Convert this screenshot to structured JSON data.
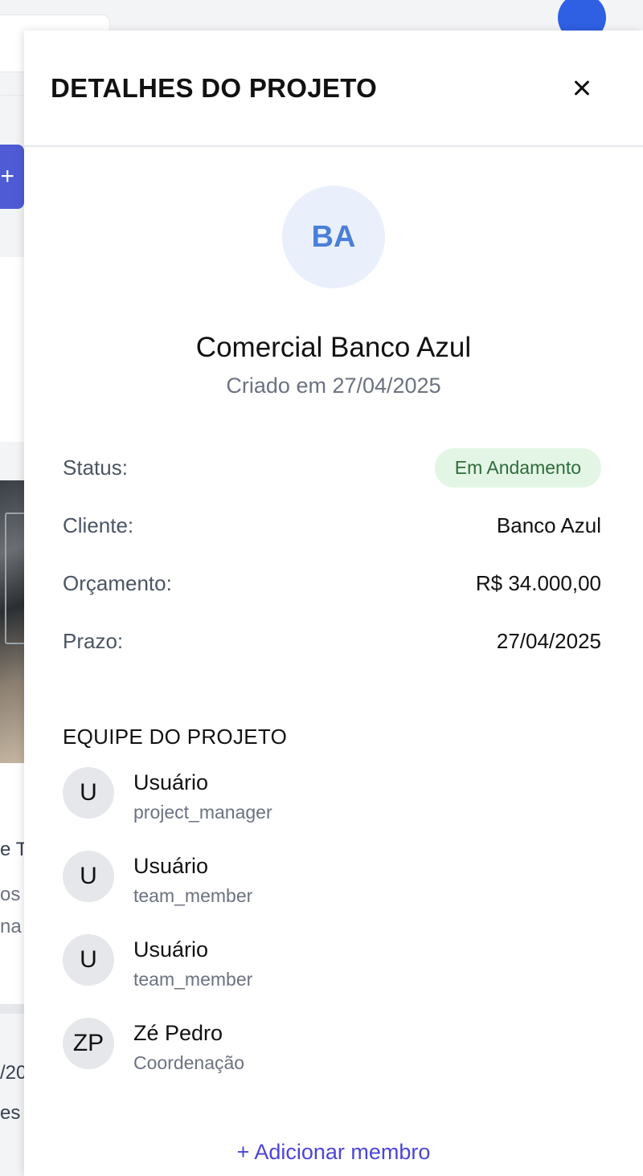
{
  "background": {
    "add_symbol": "+",
    "text_fragments": [
      "e T",
      "os",
      "na",
      "/20",
      "es"
    ]
  },
  "drawer": {
    "title": "DETALHES DO PROJETO",
    "close_icon": "close-icon"
  },
  "project": {
    "initials": "BA",
    "name": "Comercial Banco Azul",
    "created": "Criado em 27/04/2025"
  },
  "details": {
    "status_label": "Status:",
    "status_value": "Em Andamento",
    "client_label": "Cliente:",
    "client_value": "Banco Azul",
    "budget_label": "Orçamento:",
    "budget_value": "R$ 34.000,00",
    "deadline_label": "Prazo:",
    "deadline_value": "27/04/2025"
  },
  "team": {
    "title": "EQUIPE DO PROJETO",
    "members": [
      {
        "initials": "U",
        "name": "Usuário",
        "role": "project_manager"
      },
      {
        "initials": "U",
        "name": "Usuário",
        "role": "team_member"
      },
      {
        "initials": "U",
        "name": "Usuário",
        "role": "team_member"
      },
      {
        "initials": "ZP",
        "name": "Zé Pedro",
        "role": "Coordenação"
      }
    ],
    "add_label": "+ Adicionar membro"
  },
  "colors": {
    "accent": "#4c45d6",
    "status_bg": "#e3f6e6",
    "status_text": "#2f6b3a",
    "avatar_bg": "#eaf0fb",
    "avatar_text": "#4a7fd8"
  }
}
